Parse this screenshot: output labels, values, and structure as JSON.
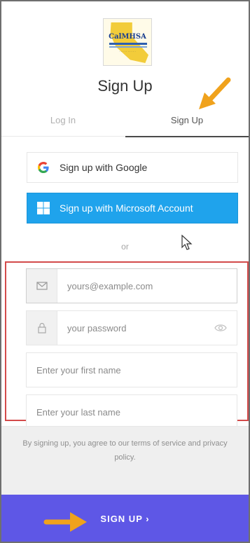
{
  "header": {
    "logo_text": "CalMHSA",
    "title": "Sign Up"
  },
  "tabs": [
    {
      "label": "Log In",
      "active": false
    },
    {
      "label": "Sign Up",
      "active": true
    }
  ],
  "social": {
    "google_label": "Sign up with Google",
    "microsoft_label": "Sign up with Microsoft Account",
    "or_label": "or"
  },
  "form": {
    "email_placeholder": "yours@example.com",
    "password_placeholder": "your password",
    "first_name_placeholder": "Enter your first name",
    "last_name_placeholder": "Enter your last name"
  },
  "terms": {
    "text": "By signing up, you agree to our terms of service and privacy policy."
  },
  "submit": {
    "label": "SIGN UP ›"
  },
  "colors": {
    "microsoft_blue": "#1fa3ec",
    "submit_purple": "#5e57e6",
    "annotation_red": "#d34a4a",
    "annotation_arrow": "#f0a21c"
  },
  "icons": [
    "google-logo-icon",
    "microsoft-logo-icon",
    "envelope-icon",
    "lock-icon",
    "eye-icon",
    "chevron-right-icon",
    "arrow-annotation-icon",
    "mouse-cursor-icon"
  ]
}
